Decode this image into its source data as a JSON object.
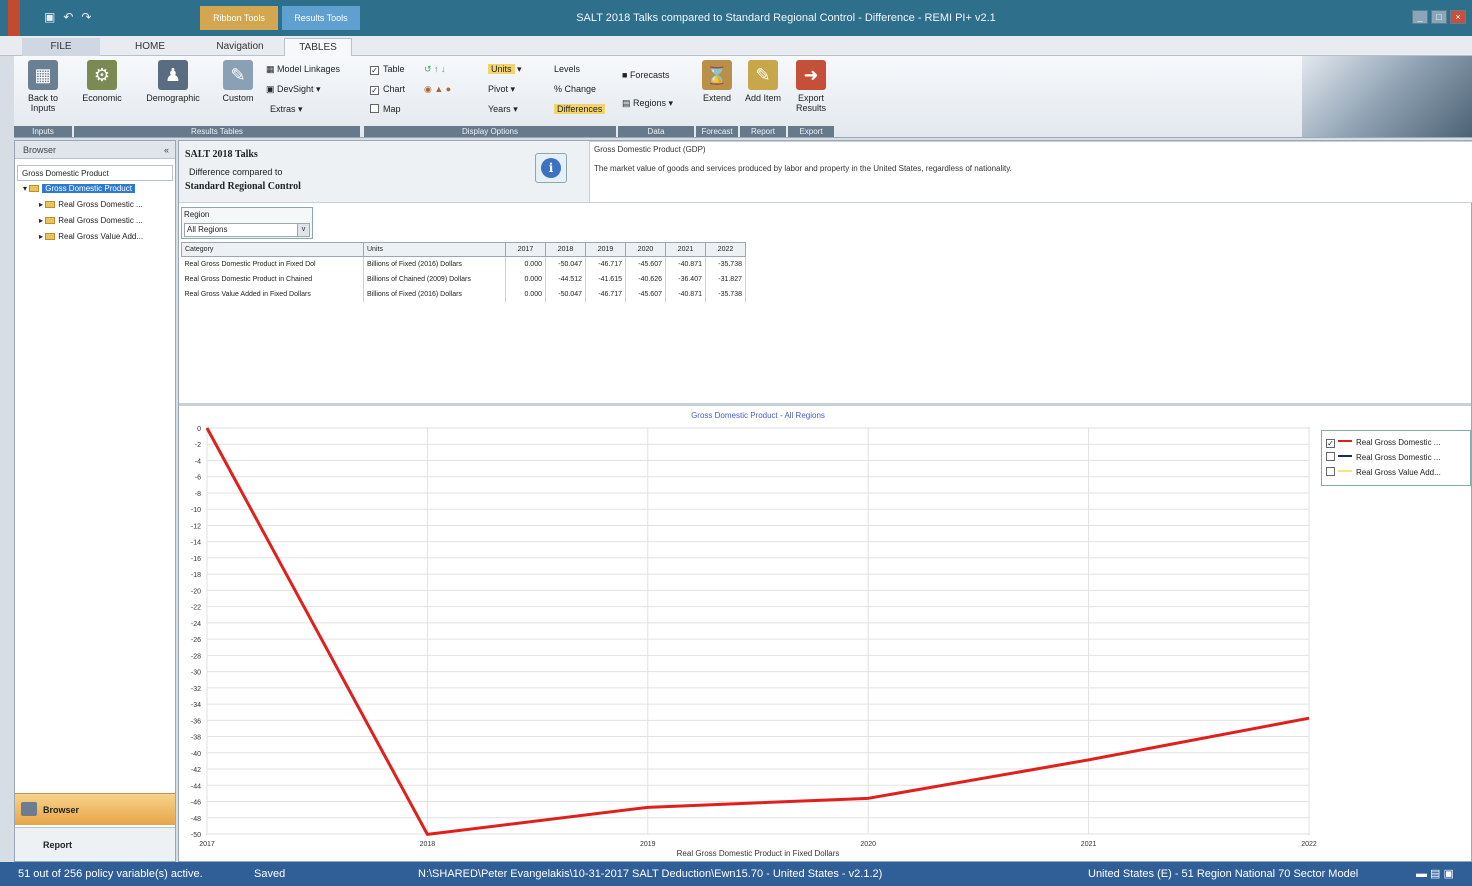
{
  "titlebar": {
    "title": "SALT 2018 Talks compared to Standard Regional Control - Difference - REMI PI+ v2.1",
    "context_tab_1": "Ribbon Tools",
    "context_tab_2": "Results Tools",
    "qat_icons": [
      "save-icon",
      "undo-icon",
      "redo-icon"
    ],
    "window_controls": [
      "_",
      "□",
      "×"
    ]
  },
  "ribbon_tabs": [
    "FILE",
    "HOME",
    "Navigation",
    "TABLES"
  ],
  "ribbon": {
    "back_to_inputs": "Back to Inputs",
    "economic": "Economic",
    "demographic": "Demographic",
    "custom": "Custom",
    "model_linkages": "Model Linkages",
    "devsight": "DevSight",
    "extras": "Extras",
    "table_check": "Table",
    "chart_check": "Chart",
    "map_check": "Map",
    "units": "Units",
    "pivot": "Pivot",
    "years": "Years",
    "levels": "Levels",
    "pct_change": "% Change",
    "differences": "Differences",
    "forecasts": "Forecasts",
    "regions": "Regions",
    "extend": "Extend",
    "add_item": "Add Item",
    "export_results": "Export Results",
    "groups": {
      "inputs": "Inputs",
      "results_tables": "Results Tables",
      "display_options": "Display Options",
      "data": "Data",
      "forecast": "Forecast",
      "report": "Report",
      "export": "Export"
    }
  },
  "browser": {
    "header": "Browser",
    "collapse": "«",
    "root": "Gross Domestic Product",
    "selected": "Gross Domestic Product",
    "children": [
      "Real Gross Domestic ...",
      "Real Gross Domestic ...",
      "Real Gross Value Add..."
    ],
    "nav_browser": "Browser",
    "nav_report": "Report"
  },
  "report": {
    "title": "SALT 2018 Talks",
    "diff_label": "Difference compared to",
    "control": "Standard Regional Control",
    "info_icon": "i"
  },
  "description": {
    "title": "Gross Domestic Product (GDP)",
    "text": "The market value of goods and services produced by labor and property in the United States, regardless of nationality."
  },
  "region": {
    "label": "Region",
    "value": "All Regions",
    "dropdown": "v"
  },
  "table": {
    "headers": [
      "Category",
      "Units",
      "2017",
      "2018",
      "2019",
      "2020",
      "2021",
      "2022"
    ],
    "rows": [
      [
        "Real Gross Domestic Product in Fixed Dol",
        "Billions of Fixed (2016) Dollars",
        "0.000",
        "-50.047",
        "-46.717",
        "-45.607",
        "-40.871",
        "-35.738"
      ],
      [
        "Real Gross Domestic Product in Chained",
        "Billions of Chained (2009) Dollars",
        "0.000",
        "-44.512",
        "-41.615",
        "-40.626",
        "-36.407",
        "-31.827"
      ],
      [
        "Real Gross Value Added in Fixed Dollars",
        "Billions of Fixed (2016) Dollars",
        "0.000",
        "-50.047",
        "-46.717",
        "-45.607",
        "-40.871",
        "-35.738"
      ]
    ]
  },
  "chart_data": {
    "type": "line",
    "title": "Gross Domestic Product - All Regions",
    "xlabel": "Real Gross Domestic Product in Fixed Dollars",
    "ylabel": "",
    "x": [
      "2017",
      "2018",
      "2019",
      "2020",
      "2021",
      "2022"
    ],
    "ylim": [
      -50,
      0
    ],
    "yticks": [
      "0",
      "-2",
      "-4",
      "-6",
      "-8",
      "-10",
      "-12",
      "-14",
      "-16",
      "-18",
      "-20",
      "-22",
      "-24",
      "-26",
      "-28",
      "-30",
      "-32",
      "-34",
      "-36",
      "-38",
      "-40",
      "-42",
      "-44",
      "-46",
      "-48",
      "-50"
    ],
    "grid": true,
    "legend_position": "top-right",
    "series": [
      {
        "name": "Real Gross Domestic ...",
        "values": [
          0.0,
          -50.047,
          -46.717,
          -45.607,
          -40.871,
          -35.738
        ],
        "color": "#e0201c",
        "checked": true
      },
      {
        "name": "Real Gross Domestic ...",
        "values": [
          0.0,
          -44.512,
          -41.615,
          -40.626,
          -36.407,
          -31.827
        ],
        "color": "#1a2a6a",
        "checked": false
      },
      {
        "name": "Real Gross Value Add...",
        "values": [
          0.0,
          -50.047,
          -46.717,
          -45.607,
          -40.871,
          -35.738
        ],
        "color": "#f0e68c",
        "checked": false
      }
    ]
  },
  "status": {
    "left": "51 out of 256 policy variable(s) active.",
    "saved": "Saved",
    "path": "N:\\SHARED\\Peter Evangelakis\\10-31-2017 SALT Deduction\\Ewn15.70 - United States - v2.1.2)",
    "model": "United States (E) - 51 Region National 70 Sector Model"
  },
  "colors": {
    "titlebar": "#2e6f8c",
    "accent_series": "#e0201c",
    "statusbar": "#2f5f96"
  }
}
